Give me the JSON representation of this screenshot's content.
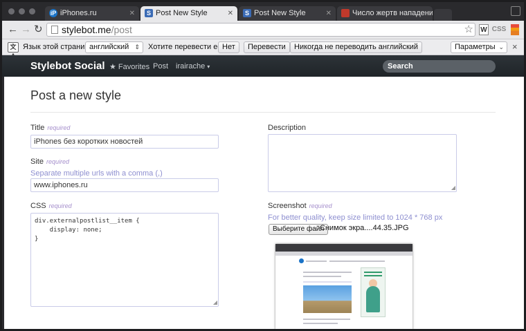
{
  "browser": {
    "tabs": [
      {
        "title": "iPhones.ru",
        "favicon": "iP",
        "favicon_color": "#1a73c7",
        "active": false
      },
      {
        "title": "Post New Style",
        "favicon": "S",
        "favicon_color": "#3b6bb5",
        "active": true
      },
      {
        "title": "Post New Style",
        "favicon": "S",
        "favicon_color": "#3b6bb5",
        "active": false
      },
      {
        "title": "Число жертв нападения",
        "favicon": "",
        "favicon_color": "#c0392b",
        "active": false
      }
    ],
    "url_host": "stylebot.me",
    "url_path": "/post",
    "ext_css_label": "CSS",
    "ext_w_label": "W"
  },
  "translate_bar": {
    "prompt": "Язык этой страницы",
    "language": "английский",
    "question": "Хотите перевести ее?",
    "no_label": "Нет",
    "translate_label": "Перевести",
    "never_label": "Никогда не переводить английский",
    "options_label": "Параметры",
    "close_glyph": "×"
  },
  "site_nav": {
    "brand": "Stylebot Social",
    "favorites": "★ Favorites",
    "post": "Post",
    "user": "irairache",
    "search_placeholder": "Search"
  },
  "form": {
    "page_title": "Post a new style",
    "required_text": "required",
    "title_label": "Title",
    "title_value": "iPhones без коротких новостей",
    "site_label": "Site",
    "site_help": "Separate multiple urls with a comma (,)",
    "site_value": "www.iphones.ru",
    "css_label": "CSS",
    "css_value": "div.externalpostlist__item {\n    display: none;\n}",
    "description_label": "Description",
    "description_value": "",
    "screenshot_label": "Screenshot",
    "screenshot_help": "For better quality, keep size limited to 1024 * 768 px",
    "file_button": "Выберите файл",
    "file_name": "Снимок экра....44.35.JPG"
  }
}
